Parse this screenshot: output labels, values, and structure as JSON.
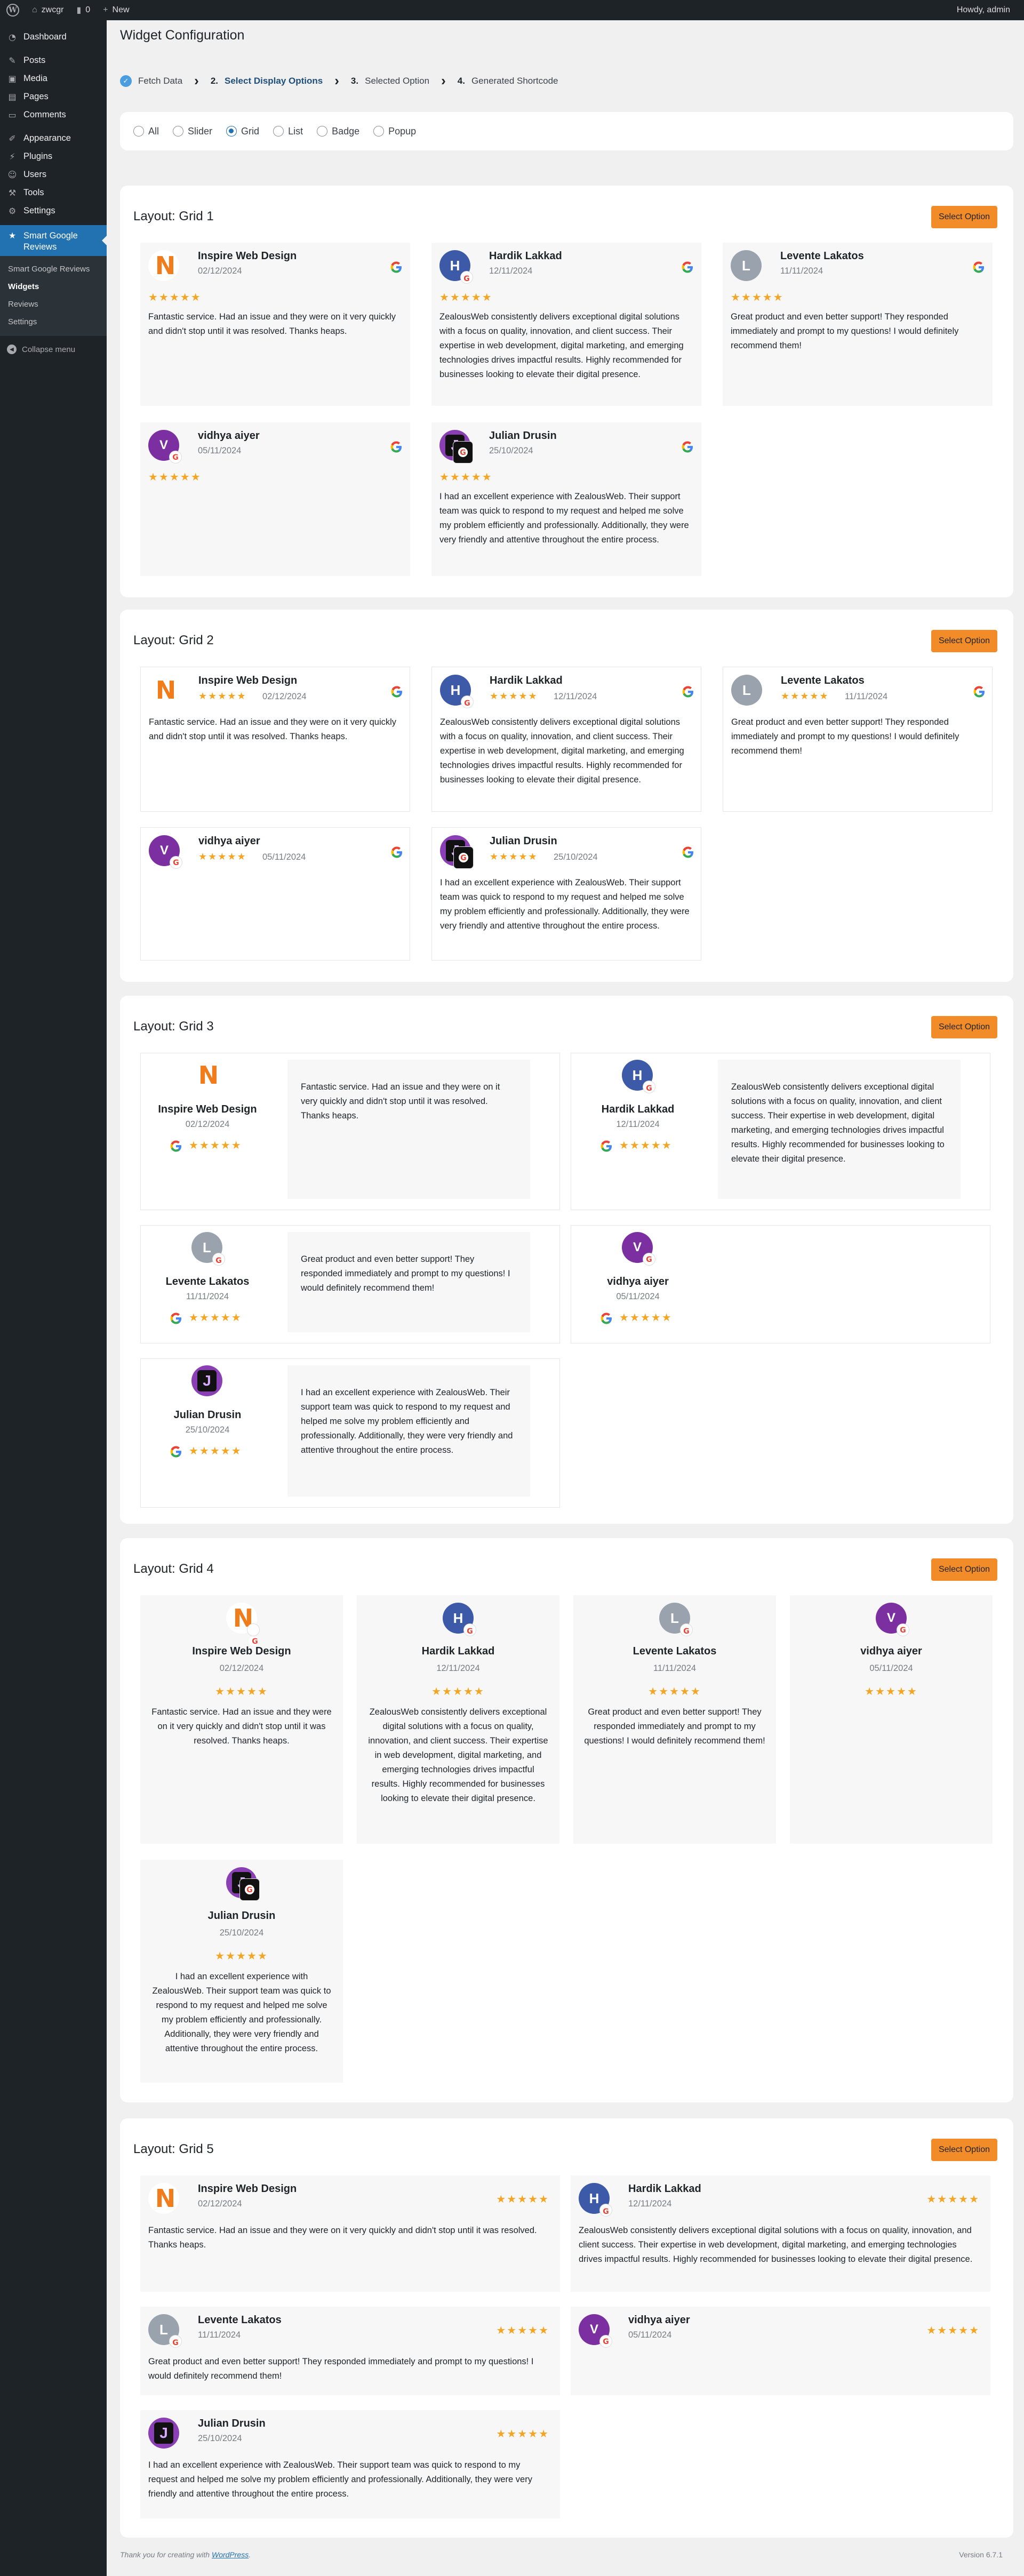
{
  "adminbar": {
    "site_name": "zwcgr",
    "comments_count": "0",
    "new_label": "New",
    "howdy": "Howdy, admin"
  },
  "sidebar": {
    "items": [
      {
        "label": "Dashboard",
        "icon": "dashboard-icon"
      },
      {
        "label": "Posts",
        "icon": "pin-icon"
      },
      {
        "label": "Media",
        "icon": "media-icon"
      },
      {
        "label": "Pages",
        "icon": "pages-icon"
      },
      {
        "label": "Comments",
        "icon": "comments-icon"
      },
      {
        "label": "Appearance",
        "icon": "brush-icon"
      },
      {
        "label": "Plugins",
        "icon": "plug-icon"
      },
      {
        "label": "Users",
        "icon": "users-icon"
      },
      {
        "label": "Tools",
        "icon": "wrench-icon"
      },
      {
        "label": "Settings",
        "icon": "settings-icon"
      },
      {
        "label": "Smart Google Reviews",
        "icon": "reviews-icon"
      }
    ],
    "submenu": [
      "Smart Google Reviews",
      "Widgets",
      "Reviews",
      "Settings"
    ],
    "collapse": "Collapse menu"
  },
  "page": {
    "title": "Widget Configuration"
  },
  "steps": [
    {
      "num": "",
      "label": "Fetch Data"
    },
    {
      "num": "2.",
      "label": "Select Display Options"
    },
    {
      "num": "3.",
      "label": "Selected Option"
    },
    {
      "num": "4.",
      "label": "Generated Shortcode"
    }
  ],
  "types": [
    "All",
    "Slider",
    "Grid",
    "List",
    "Badge",
    "Popup"
  ],
  "selected_type": "Grid",
  "select_button": "Select Option",
  "stars": "★★★★★",
  "rating": 5,
  "layouts": [
    "Layout: Grid 1",
    "Layout: Grid 2",
    "Layout: Grid 3",
    "Layout: Grid 4",
    "Layout: Grid 5"
  ],
  "reviews": [
    {
      "name": "Inspire Web Design",
      "date": "02/12/2024",
      "text": "Fantastic service. Had an issue and they were on it very quickly and didn't stop until it was resolved. Thanks heaps.",
      "initial": "N"
    },
    {
      "name": "Hardik Lakkad",
      "date": "12/11/2024",
      "text": "ZealousWeb consistently delivers exceptional digital solutions with a focus on quality, innovation, and client success. Their expertise in web development, digital marketing, and emerging technologies drives impactful results. Highly recommended for businesses looking to elevate their digital presence.",
      "initial": "H"
    },
    {
      "name": "Levente Lakatos",
      "date": "11/11/2024",
      "text": "Great product and even better support! They responded immediately and prompt to my questions! I would definitely recommend them!",
      "initial": "L"
    },
    {
      "name": "vidhya aiyer",
      "date": "05/11/2024",
      "text": "",
      "initial": "V"
    },
    {
      "name": "Julian Drusin",
      "date": "25/10/2024",
      "text": "I had an excellent experience with ZealousWeb. Their support team was quick to respond to my request and helped me solve my problem efficiently and professionally. Additionally, they were very friendly and attentive throughout the entire process.",
      "initial": "J"
    }
  ],
  "footer": {
    "text": "Thank you for creating with",
    "link": "WordPress",
    "version": "Version 6.7.1"
  },
  "colors": {
    "accent": "#2271b1",
    "button": "#f28c28",
    "star": "#f5a524",
    "sidebar": "#1d2327"
  }
}
